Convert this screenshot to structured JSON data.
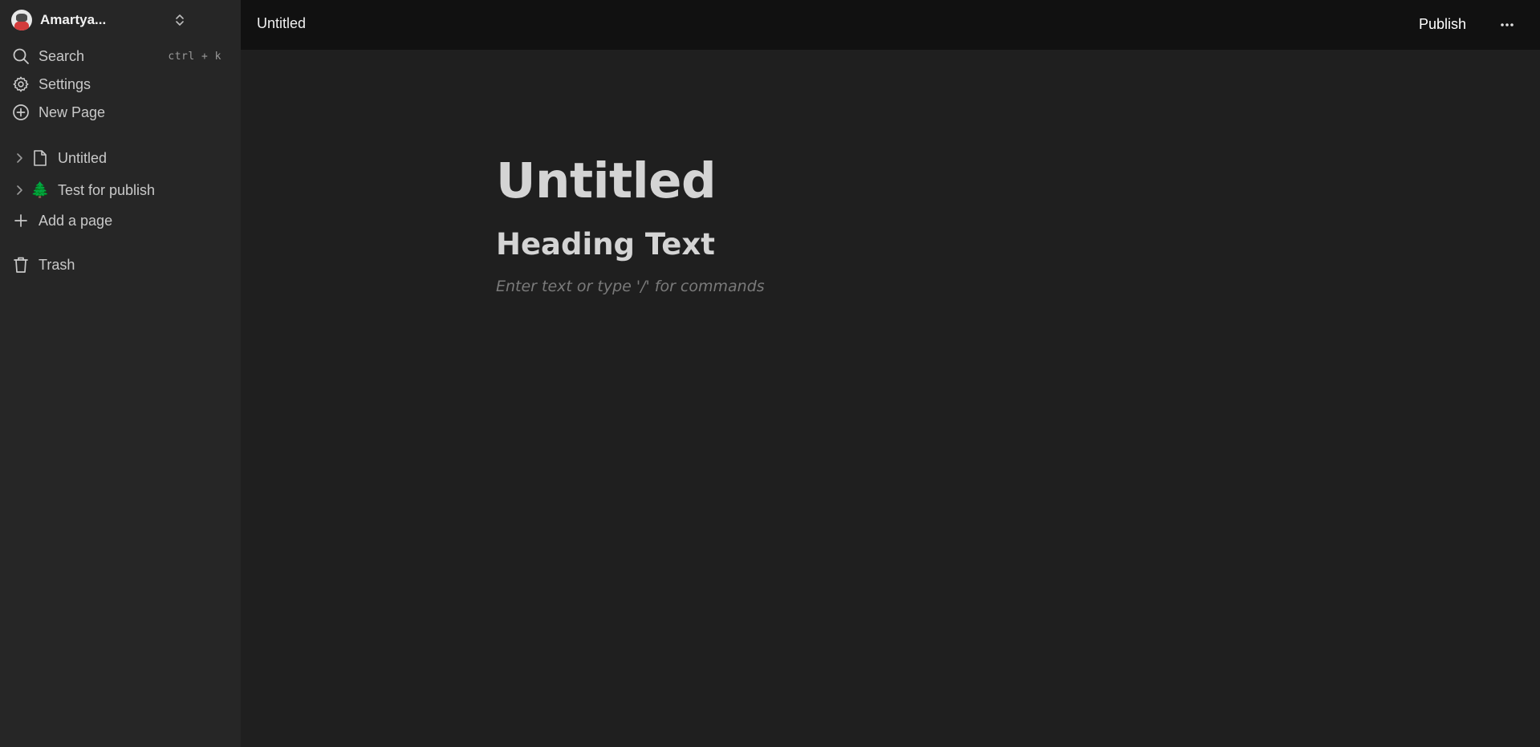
{
  "sidebar": {
    "workspace": {
      "name": "Amartya..."
    },
    "nav": {
      "search_label": "Search",
      "search_shortcut": "ctrl + k",
      "settings_label": "Settings",
      "new_page_label": "New Page"
    },
    "pages": [
      {
        "label": "Untitled",
        "icon": "page-icon"
      },
      {
        "label": "Test for publish",
        "icon": "🌲"
      }
    ],
    "add_page_label": "Add a page",
    "trash_label": "Trash"
  },
  "topbar": {
    "title": "Untitled",
    "publish_label": "Publish"
  },
  "document": {
    "title": "Untitled",
    "heading": "Heading Text",
    "placeholder": "Enter text or type '/' for commands"
  },
  "colors": {
    "sidebar_bg": "#262626",
    "topbar_bg": "#111111",
    "main_bg": "#1f1f1f",
    "text": "#c9c9c9",
    "placeholder": "#7a7a7a"
  }
}
